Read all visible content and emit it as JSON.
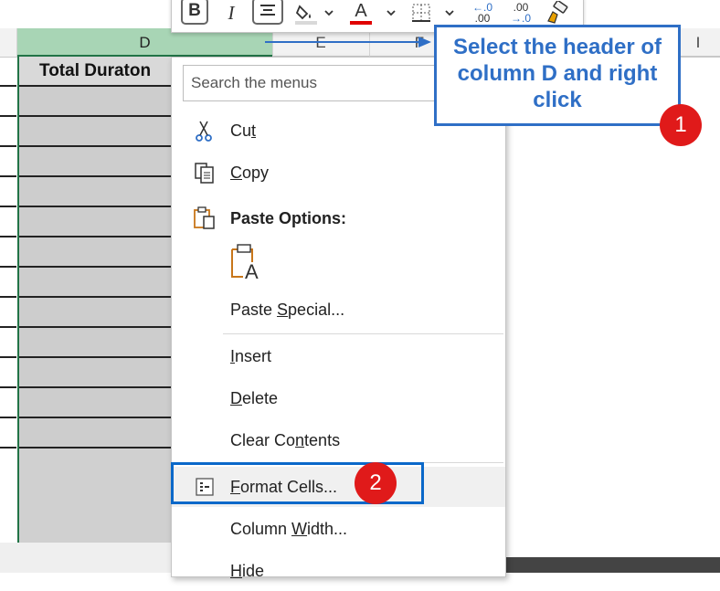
{
  "columns": {
    "d": "D",
    "e": "E",
    "f": "F",
    "i": "I"
  },
  "cell_d_header": "Total Duraton",
  "toolbar": {
    "bold": "B",
    "italic": "I",
    "font_color_letter": "A",
    "increase_decimal_top": "←.0",
    "increase_decimal_bottom": ".00",
    "decrease_decimal_top": ".00",
    "decrease_decimal_bottom": "→.0"
  },
  "context_menu": {
    "search_placeholder": "Search the menus",
    "cut": {
      "pre": "Cu",
      "u": "t",
      "post": ""
    },
    "copy": {
      "pre": "",
      "u": "C",
      "post": "opy"
    },
    "paste_options": "Paste Options:",
    "paste_special": {
      "pre": "Paste ",
      "u": "S",
      "post": "pecial..."
    },
    "insert": {
      "pre": "",
      "u": "I",
      "post": "nsert"
    },
    "delete": {
      "pre": "",
      "u": "D",
      "post": "elete"
    },
    "clear_contents": {
      "pre": "Clear Co",
      "u": "n",
      "post": "tents"
    },
    "format_cells": {
      "pre": "",
      "u": "F",
      "post": "ormat Cells..."
    },
    "column_width": {
      "pre": "Column ",
      "u": "W",
      "post": "idth..."
    },
    "hide": {
      "pre": "",
      "u": "H",
      "post": "ide"
    }
  },
  "callout": {
    "line1": "Select the header of",
    "line2": "column D and right",
    "line3": "click"
  },
  "badges": {
    "step1": "1",
    "step2": "2"
  },
  "colors": {
    "accent_blue": "#2f6fc6",
    "badge_red": "#e01a1a",
    "selected_header": "#a8d5b5",
    "excel_green": "#217346"
  }
}
